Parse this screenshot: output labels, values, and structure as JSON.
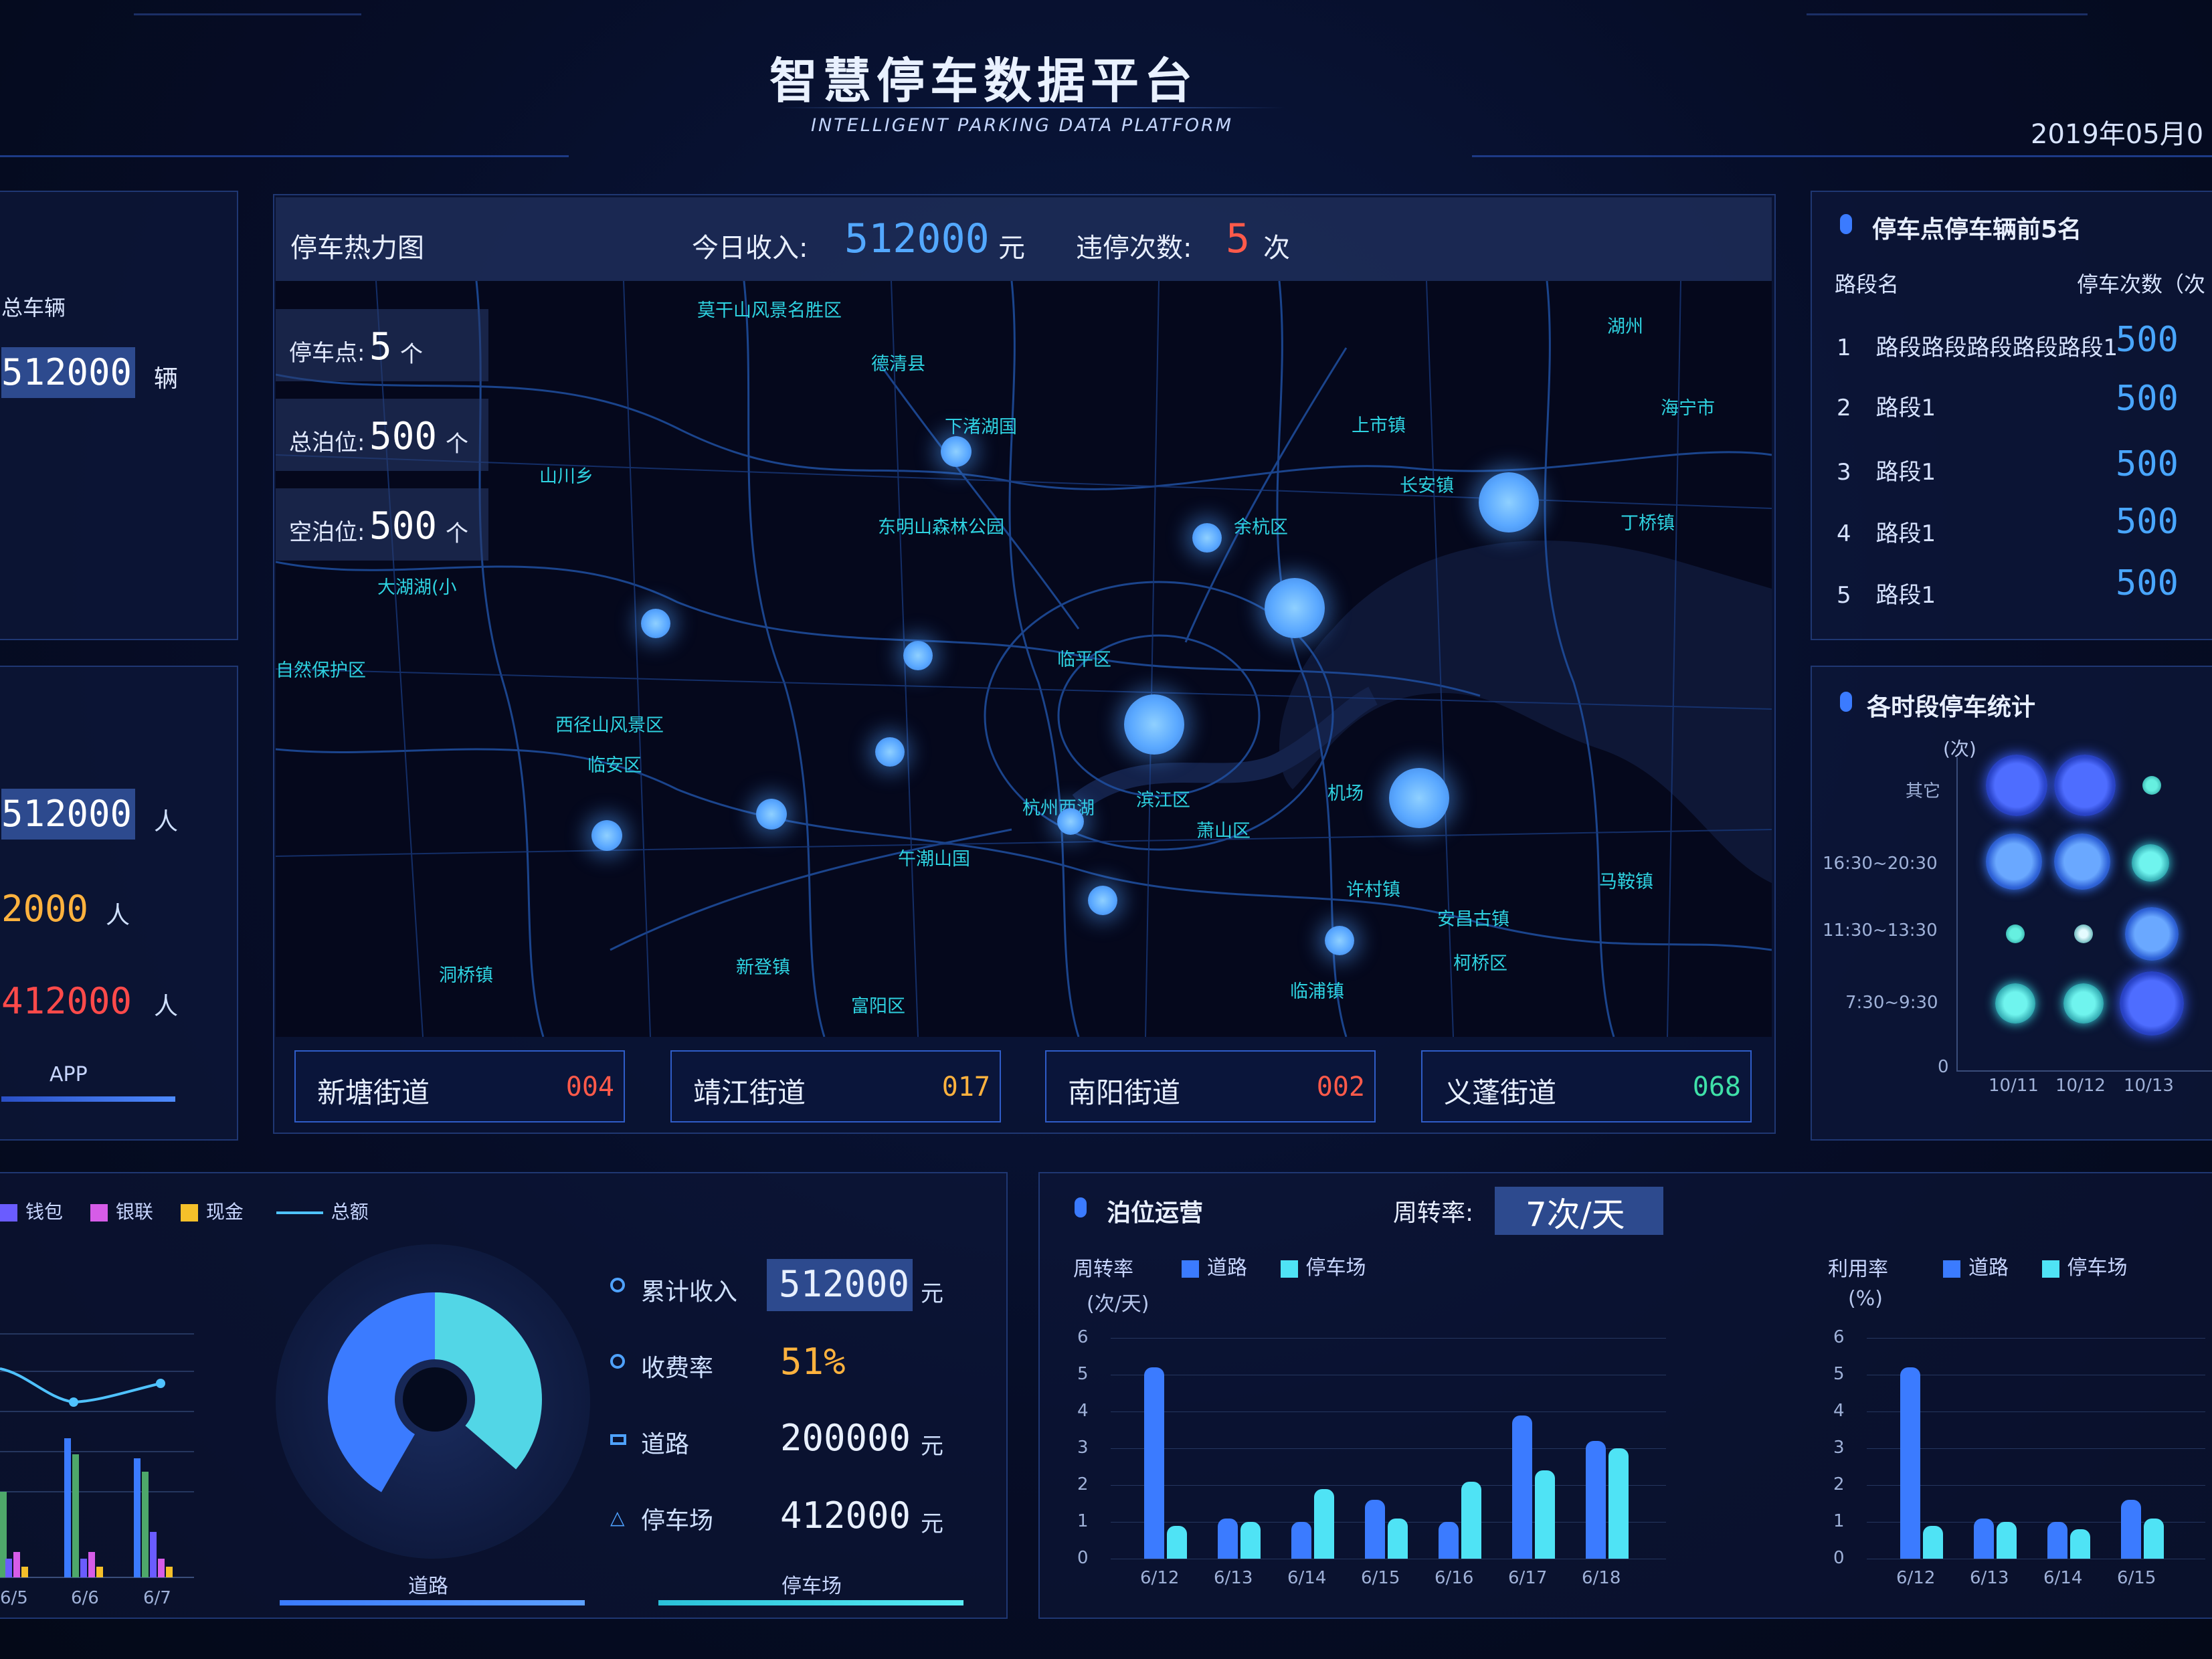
{
  "header": {
    "title": "智慧停车数据平台",
    "subtitle": "INTELLIGENT PARKING DATA PLATFORM",
    "date": "2019年05月0"
  },
  "left_top": {
    "title": "总车辆",
    "value": "512000",
    "unit": "辆"
  },
  "left_mid": {
    "rows": [
      {
        "value": "512000",
        "unit": "人",
        "color": "#ffffff"
      },
      {
        "value": "2000",
        "unit": "人",
        "color": "#ffb23e"
      },
      {
        "value": "412000",
        "unit": "人",
        "color": "#ff4a4a"
      }
    ],
    "footer": "APP"
  },
  "map_header": {
    "title": "停车热力图",
    "income_label": "今日收入:",
    "income_value": "512000",
    "income_unit": "元",
    "violation_label": "违停次数:",
    "violation_value": "5",
    "violation_unit": "次"
  },
  "map_stats": [
    {
      "label": "停车点:",
      "value": "5",
      "unit": "个"
    },
    {
      "label": "总泊位:",
      "value": "500",
      "unit": "个"
    },
    {
      "label": "空泊位:",
      "value": "500",
      "unit": "个"
    }
  ],
  "map_labels": [
    "莫干山风景名胜区",
    "德清县",
    "下渚湖国",
    "东明山森林公园",
    "余杭区",
    "临平区",
    "杭州西湖",
    "滨江区",
    "萧山区",
    "机场",
    "西径山风景区",
    "临安区",
    "午潮山国",
    "安昌古镇",
    "柯桥区",
    "富阳区",
    "大湖湖(小",
    "上市镇",
    "海宁市",
    "长安镇",
    "丁桥镇",
    "许村镇",
    "马鞍镇",
    "临浦镇",
    "新登镇",
    "洞桥镇",
    "湖州",
    "山川乡",
    "自然保护区"
  ],
  "streets": [
    {
      "name": "新塘街道",
      "code": "004",
      "color": "#ff5a4a"
    },
    {
      "name": "靖江街道",
      "code": "017",
      "color": "#ffb23e"
    },
    {
      "name": "南阳街道",
      "code": "002",
      "color": "#ff5a4a"
    },
    {
      "name": "义蓬街道",
      "code": "068",
      "color": "#3fe0a8"
    }
  ],
  "ranking": {
    "title": "停车点停车辆前5名",
    "col_name": "路段名",
    "col_count": "停车次数（次",
    "rows": [
      {
        "rank": "1",
        "name": "路段路段路段路段路段1",
        "value": "500"
      },
      {
        "rank": "2",
        "name": "路段1",
        "value": "500"
      },
      {
        "rank": "3",
        "name": "路段1",
        "value": "500"
      },
      {
        "rank": "4",
        "name": "路段1",
        "value": "500"
      },
      {
        "rank": "5",
        "name": "路段1",
        "value": "500"
      }
    ]
  },
  "time_stats": {
    "title": "各时段停车统计",
    "unit": "(次)",
    "y_labels": [
      "其它",
      "16:30~20:30",
      "11:30~13:30",
      "7:30~9:30",
      "0"
    ],
    "x_labels": [
      "10/11",
      "10/12",
      "10/13"
    ]
  },
  "revenue": {
    "legend": [
      "钱包",
      "银联",
      "现金",
      "总额"
    ],
    "x_labels": [
      "6/5",
      "6/6",
      "6/7"
    ],
    "donut_labels": [
      "道路",
      "停车场"
    ],
    "items": [
      {
        "label": "累计收入",
        "value": "512000",
        "unit": "元",
        "color": "#e8f0ff"
      },
      {
        "label": "收费率",
        "value": "51%",
        "unit": "",
        "color": "#ffb23e"
      },
      {
        "label": "道路",
        "value": "200000",
        "unit": "元",
        "color": "#e8f0ff"
      },
      {
        "label": "停车场",
        "value": "412000",
        "unit": "元",
        "color": "#e8f0ff"
      }
    ]
  },
  "ops": {
    "title": "泊位运营",
    "rate_label": "周转率:",
    "rate_value": "7次/天",
    "left_chart": {
      "ylabel": "周转率",
      "unit": "(次/天)"
    },
    "right_chart": {
      "ylabel": "利用率",
      "unit": "(%)"
    },
    "legend": [
      "道路",
      "停车场"
    ],
    "y_ticks": [
      "6",
      "5",
      "4",
      "3",
      "2",
      "1",
      "0"
    ]
  },
  "chart_data": [
    {
      "type": "bar",
      "title": "",
      "xlabel": "",
      "ylabel": "周转率 (次/天)",
      "ylim": [
        0,
        6
      ],
      "categories": [
        "6/12",
        "6/13",
        "6/14",
        "6/15",
        "6/16",
        "6/17",
        "6/18"
      ],
      "series": [
        {
          "name": "道路",
          "values": [
            5.2,
            1.1,
            1.0,
            1.6,
            1.0,
            3.9,
            3.2
          ],
          "color": "#3b7bff"
        },
        {
          "name": "停车场",
          "values": [
            0.9,
            1.0,
            1.9,
            1.1,
            2.1,
            2.4,
            3.0
          ],
          "color": "#4fe3f5"
        }
      ]
    },
    {
      "type": "bar",
      "title": "",
      "xlabel": "",
      "ylabel": "利用率 (%)",
      "ylim": [
        0,
        6
      ],
      "categories": [
        "6/12",
        "6/13",
        "6/14",
        "6/15"
      ],
      "series": [
        {
          "name": "道路",
          "values": [
            5.2,
            1.1,
            1.0,
            1.6
          ],
          "color": "#3b7bff"
        },
        {
          "name": "停车场",
          "values": [
            0.9,
            1.0,
            0.8,
            1.1
          ],
          "color": "#4fe3f5"
        }
      ]
    }
  ],
  "colors": {
    "accent": "#3b7bff",
    "cyan": "#4fe3f5",
    "orange": "#ffb23e",
    "red": "#ff4a4a"
  }
}
